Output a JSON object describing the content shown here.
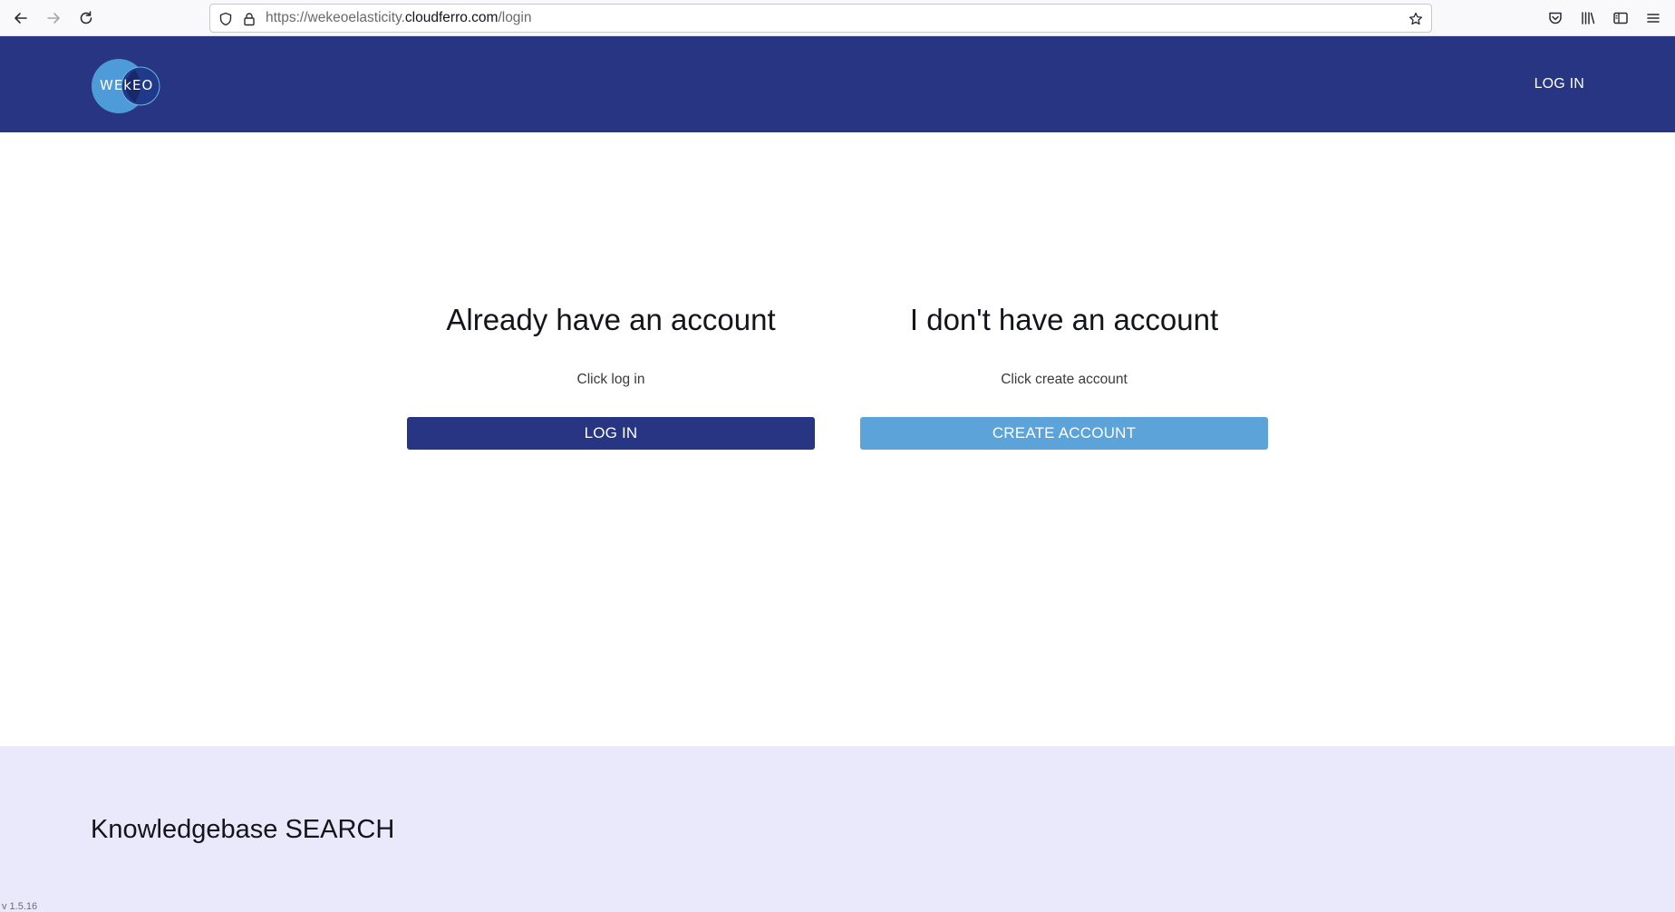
{
  "browser": {
    "url_prefix": "https://wekeoelasticity.",
    "url_domain": "cloudferro.com",
    "url_path": "/login"
  },
  "header": {
    "logo_text": "WEkEO",
    "login_link": "LOG IN"
  },
  "login_panel": {
    "title": "Already have an account",
    "subtitle": "Click log in",
    "button": "LOG IN"
  },
  "register_panel": {
    "title": "I don't have an account",
    "subtitle": "Click create account",
    "button": "CREATE ACCOUNT"
  },
  "footer": {
    "title": "Knowledgebase SEARCH",
    "version": "v 1.5.16"
  },
  "colors": {
    "brand_navy": "#273582",
    "accent_blue": "#5ba3d9",
    "footer_bg": "#e9e9fb"
  }
}
